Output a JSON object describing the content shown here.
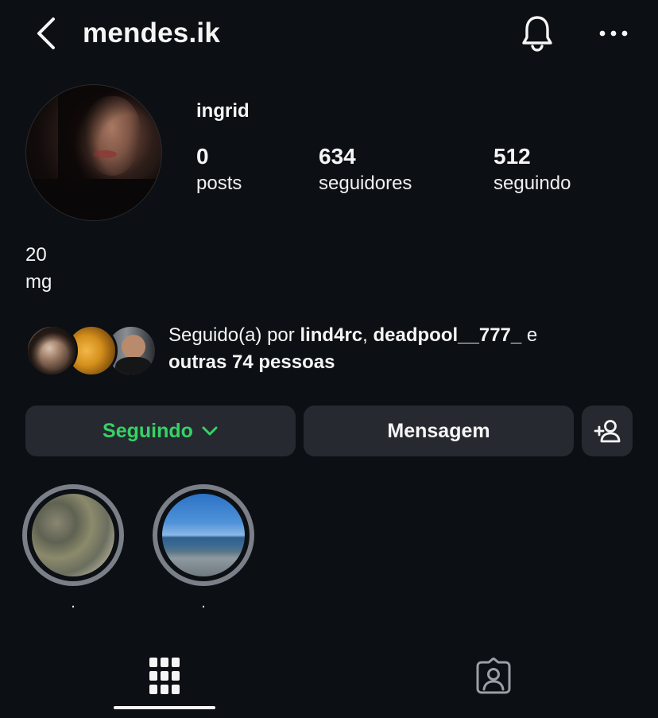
{
  "header": {
    "username": "mendes.ik"
  },
  "profile": {
    "display_name": "ingrid",
    "stats": [
      {
        "value": "0",
        "label": "posts"
      },
      {
        "value": "634",
        "label": "seguidores"
      },
      {
        "value": "512",
        "label": "seguindo"
      }
    ],
    "bio_lines": [
      "20",
      "mg"
    ]
  },
  "followed_by": {
    "prefix": "Seguido(a) por ",
    "user1": "lind4rc",
    "sep": ", ",
    "user2": "deadpool__777_",
    "conj": " e",
    "others": "outras 74 pessoas"
  },
  "actions": {
    "following_label": "Seguindo",
    "message_label": "Mensagem"
  },
  "highlights": [
    {
      "label": "."
    },
    {
      "label": "."
    }
  ],
  "icons": {
    "back": "chevron-left-icon",
    "notifications": "bell-icon",
    "more": "more-horizontal-icon",
    "add_user": "add-user-icon",
    "grid": "grid-icon",
    "tagged": "tagged-icon"
  },
  "colors": {
    "background": "#0c1014",
    "button_bg": "#262a30",
    "following_green": "#36d266",
    "text": "#f5f5f5"
  }
}
